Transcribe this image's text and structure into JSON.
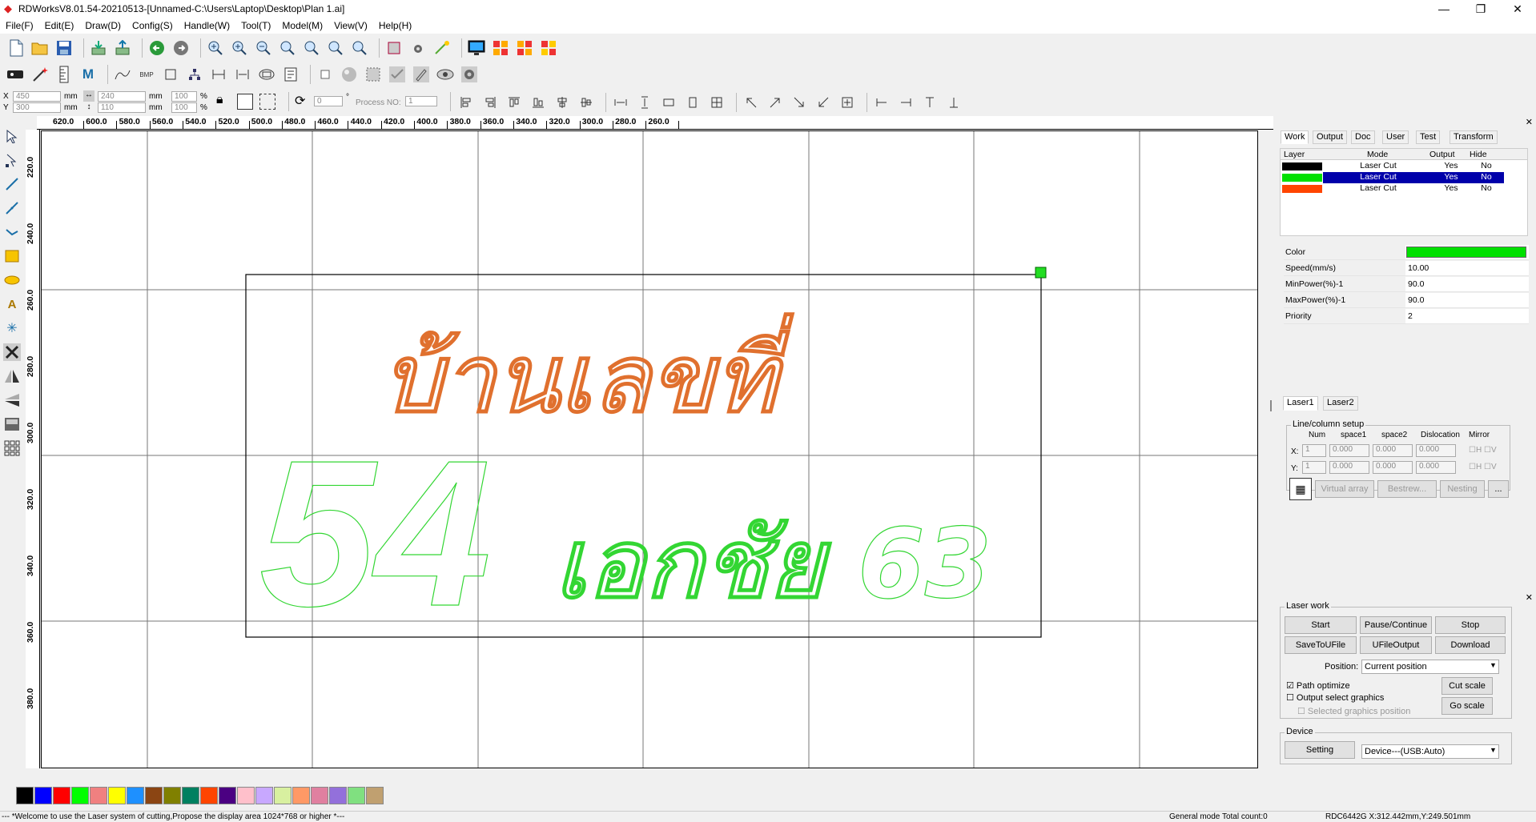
{
  "titlebar": {
    "title": "RDWorksV8.01.54-20210513-[Unnamed-C:\\Users\\Laptop\\Desktop\\Plan 1.ai]"
  },
  "menu": [
    "File(F)",
    "Edit(E)",
    "Draw(D)",
    "Config(S)",
    "Handle(W)",
    "Tool(T)",
    "Model(M)",
    "View(V)",
    "Help(H)"
  ],
  "toolbar3": {
    "x_label": "X",
    "y_label": "Y",
    "x_val": "450",
    "y_val": "300",
    "mm": "mm",
    "w_val": "240",
    "h_val": "110",
    "w_pct": "100",
    "h_pct": "100",
    "pct": "%",
    "angle_val": "0",
    "deg": "°",
    "process_label": "Process NO:",
    "process_val": "1"
  },
  "ruler": {
    "h_ticks": [
      "620.0",
      "600.0",
      "580.0",
      "560.0",
      "540.0",
      "520.0",
      "500.0",
      "480.0",
      "460.0",
      "440.0",
      "420.0",
      "400.0",
      "380.0",
      "360.0",
      "340.0",
      "320.0",
      "300.0",
      "280.0",
      "260.0"
    ],
    "v_ticks": [
      "220.0",
      "240.0",
      "260.0",
      "280.0",
      "300.0",
      "320.0",
      "340.0",
      "360.0",
      "380.0"
    ]
  },
  "canvas": {
    "thai_text_top": "บ้านเลขที่",
    "num_left": "54",
    "thai_text_bottom": "เอกชัย 63",
    "colors": {
      "top_text": "#e0702e",
      "bottom_text": "#33d633",
      "frame": "#000000"
    }
  },
  "work_panel": {
    "tabs": [
      "Work",
      "Output",
      "Doc",
      "User",
      "Test",
      "Transform"
    ],
    "layer_headers": [
      "Layer",
      "Mode",
      "Output",
      "Hide"
    ],
    "layers": [
      {
        "color": "#000000",
        "mode": "Laser Cut",
        "output": "Yes",
        "hide": "No"
      },
      {
        "color": "#00e000",
        "mode": "Laser Cut",
        "output": "Yes",
        "hide": "No"
      },
      {
        "color": "#ff4500",
        "mode": "Laser Cut",
        "output": "Yes",
        "hide": "No"
      }
    ],
    "props": [
      {
        "label": "Color",
        "value": ""
      },
      {
        "label": "Speed(mm/s)",
        "value": "10.00"
      },
      {
        "label": "MinPower(%)-1",
        "value": "90.0"
      },
      {
        "label": "MaxPower(%)-1",
        "value": "90.0"
      },
      {
        "label": "Priority",
        "value": "2"
      }
    ],
    "selected_color": "#00e000",
    "laser_tabs": [
      "Laser1",
      "Laser2"
    ],
    "array": {
      "title": "Line/column setup",
      "headers": [
        "Num",
        "space1",
        "space2",
        "Dislocation",
        "Mirror"
      ],
      "x_label": "X:",
      "y_label": "Y:",
      "x": {
        "num": "1",
        "space1": "0.000",
        "space2": "0.000",
        "dis": "0.000"
      },
      "y": {
        "num": "1",
        "space1": "0.000",
        "space2": "0.000",
        "dis": "0.000"
      },
      "h": "H",
      "v": "V",
      "buttons": [
        "Virtual array",
        "Bestrew...",
        "Nesting",
        "..."
      ]
    }
  },
  "laser_work": {
    "title": "Laser work",
    "buttons": [
      "Start",
      "Pause/Continue",
      "Stop",
      "SaveToUFile",
      "UFileOutput",
      "Download"
    ],
    "position_label": "Position:",
    "position_value": "Current position",
    "path_optimize": "Path optimize",
    "output_select": "Output select graphics",
    "selected_position": "Selected graphics position",
    "cut_scale": "Cut scale",
    "go_scale": "Go scale",
    "device_title": "Device",
    "setting": "Setting",
    "device_value": "Device---(USB:Auto)"
  },
  "palette": [
    "#000000",
    "#0000ff",
    "#ff0000",
    "#00ff00",
    "#f08080",
    "#ffff00",
    "#1e90ff",
    "#8b4513",
    "#808000",
    "#008060",
    "#ff4500",
    "#4b0082",
    "#ffc0cb",
    "#c8a8ff",
    "#d8f0a0",
    "#ff9966",
    "#e080a0",
    "#9370db",
    "#80e080",
    "#c0a070"
  ],
  "status": {
    "message": "--- *Welcome to use the Laser system of cutting,Propose the display area 1024*768 or higher *---",
    "mode": "General mode Total count:0",
    "coords": "RDC6442G X:312.442mm,Y:249.501mm"
  }
}
